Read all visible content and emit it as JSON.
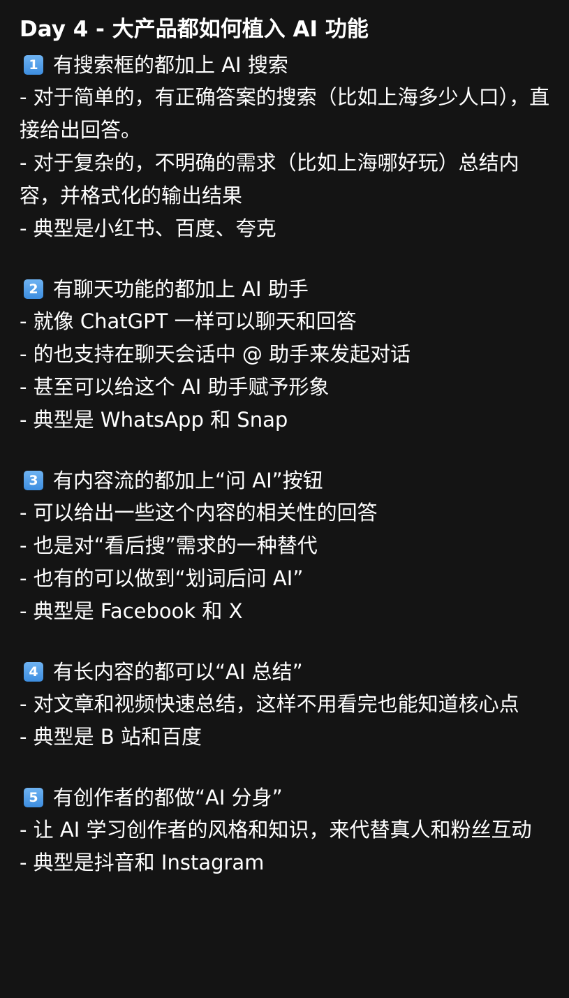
{
  "title": "Day 4 - 大产品都如何植入 AI 功能",
  "sections": [
    {
      "number": "1",
      "heading": "有搜索框的都加上 AI 搜索",
      "items": [
        "- 对于简单的，有正确答案的搜索（比如上海多少人口），直接给出回答。",
        "- 对于复杂的，不明确的需求（比如上海哪好玩）总结内容，并格式化的输出结果",
        "- 典型是小红书、百度、夸克"
      ]
    },
    {
      "number": "2",
      "heading": "有聊天功能的都加上 AI 助手",
      "items": [
        "- 就像 ChatGPT 一样可以聊天和回答",
        "- 的也支持在聊天会话中 @ 助手来发起对话",
        "- 甚至可以给这个 AI 助手赋予形象",
        "- 典型是 WhatsApp 和 Snap"
      ]
    },
    {
      "number": "3",
      "heading": "有内容流的都加上“问 AI”按钮",
      "items": [
        "- 可以给出一些这个内容的相关性的回答",
        "- 也是对“看后搜”需求的一种替代",
        "- 也有的可以做到“划词后问 AI”",
        "- 典型是 Facebook 和 X"
      ]
    },
    {
      "number": "4",
      "heading": "有长内容的都可以“AI 总结”",
      "items": [
        "- 对文章和视频快速总结，这样不用看完也能知道核心点",
        "- 典型是 B 站和百度"
      ]
    },
    {
      "number": "5",
      "heading": "有创作者的都做“AI 分身”",
      "items": [
        "- 让 AI 学习创作者的风格和知识，来代替真人和粉丝互动",
        "- 典型是抖音和 Instagram"
      ]
    }
  ]
}
